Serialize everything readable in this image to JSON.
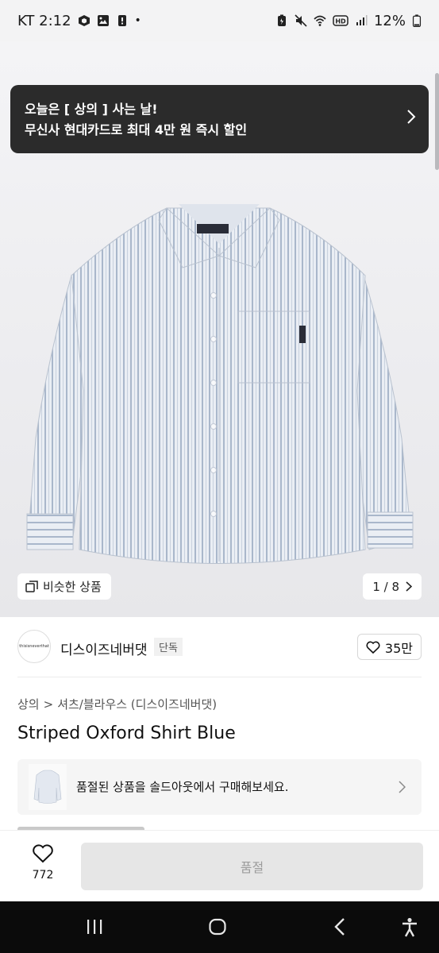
{
  "status_bar": {
    "carrier_time": "KT 2:12",
    "dot": "•",
    "battery": "12%",
    "left_icons": [
      "package-icon",
      "gallery-icon",
      "alert-icon"
    ],
    "right_icons": [
      "battery-saver-icon",
      "mute-icon",
      "wifi-icon",
      "hd-icon",
      "signal-icon",
      "battery-icon"
    ]
  },
  "promo": {
    "line1": "오늘은 [ 상의 ] 사는 날!",
    "line2": "무신사 현대카드로 최대 4만 원 즉시 할인"
  },
  "gallery": {
    "similar_label": "비슷한 상품",
    "page_indicator": "1 / 8",
    "image": "striped-oxford-shirt"
  },
  "brand": {
    "logo_text": "thisisneverthat",
    "name": "디스이즈네버댓",
    "badge": "단독",
    "like_count": "35만"
  },
  "breadcrumb": {
    "category": "상의",
    "separator": ">",
    "subcategory": "셔츠/블라우스 (디스이즈네버댓)"
  },
  "product": {
    "title": "Striped Oxford Shirt Blue"
  },
  "soldout": {
    "message": "품절된 상품을 솔드아웃에서 구매해보세요."
  },
  "action_bar": {
    "wish_count": "772",
    "buy_label": "품절"
  },
  "nav_bar": {
    "icons": [
      "recent-apps-icon",
      "home-icon",
      "back-icon",
      "accessibility-icon"
    ]
  },
  "colors": {
    "promo_bg": "#2b2b2b",
    "disabled_button": "#e6e6e6",
    "shirt_base": "#e9edf3",
    "shirt_stripe": "#aab8cc"
  }
}
